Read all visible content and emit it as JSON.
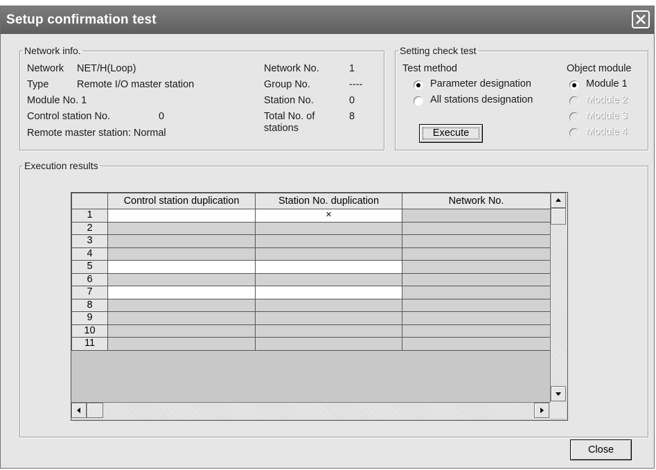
{
  "window": {
    "title": "Setup confirmation test"
  },
  "network_info": {
    "legend": "Network info.",
    "network_label": "Network",
    "network_value": "NET/H(Loop)",
    "type_label": "Type",
    "type_value": "Remote I/O master station",
    "module_no": "Module No. 1",
    "control_station_label": "Control station No.",
    "control_station_value": "0",
    "remote_master": "Remote master station: Normal",
    "network_no_label": "Network No.",
    "network_no_value": "1",
    "group_no_label": "Group No.",
    "group_no_value": "----",
    "station_no_label": "Station No.",
    "station_no_value": "0",
    "total_label_1": "Total No. of",
    "total_label_2": "stations",
    "total_value": "8"
  },
  "setting_check": {
    "legend": "Setting check test",
    "test_method_label": "Test method",
    "object_module_label": "Object module",
    "param_designation": "Parameter designation",
    "all_stations": "All stations designation",
    "execute": "Execute",
    "module1": "Module 1",
    "module2": "Module 2",
    "module3": "Module 3",
    "module4": "Module 4"
  },
  "results": {
    "legend": "Execution results",
    "columns": [
      "Control station duplication",
      "Station No. duplication",
      "Network No."
    ],
    "rows": [
      {
        "no": "1",
        "c1": "",
        "c2": "×",
        "c3": ""
      },
      {
        "no": "2",
        "c1": "",
        "c2": "",
        "c3": ""
      },
      {
        "no": "3",
        "c1": "",
        "c2": "",
        "c3": ""
      },
      {
        "no": "4",
        "c1": "",
        "c2": "",
        "c3": ""
      },
      {
        "no": "5",
        "c1": "",
        "c2": "",
        "c3": ""
      },
      {
        "no": "6",
        "c1": "",
        "c2": "",
        "c3": ""
      },
      {
        "no": "7",
        "c1": "",
        "c2": "",
        "c3": ""
      },
      {
        "no": "8",
        "c1": "",
        "c2": "",
        "c3": ""
      },
      {
        "no": "9",
        "c1": "",
        "c2": "",
        "c3": ""
      },
      {
        "no": "10",
        "c1": "",
        "c2": "",
        "c3": ""
      },
      {
        "no": "11",
        "c1": "",
        "c2": "",
        "c3": ""
      }
    ]
  },
  "footer": {
    "close": "Close"
  },
  "icons": {
    "title_close": "close-icon",
    "scroll_up": "arrow-up-icon",
    "scroll_down": "arrow-down-icon",
    "scroll_left": "arrow-left-icon",
    "scroll_right": "arrow-right-icon"
  }
}
